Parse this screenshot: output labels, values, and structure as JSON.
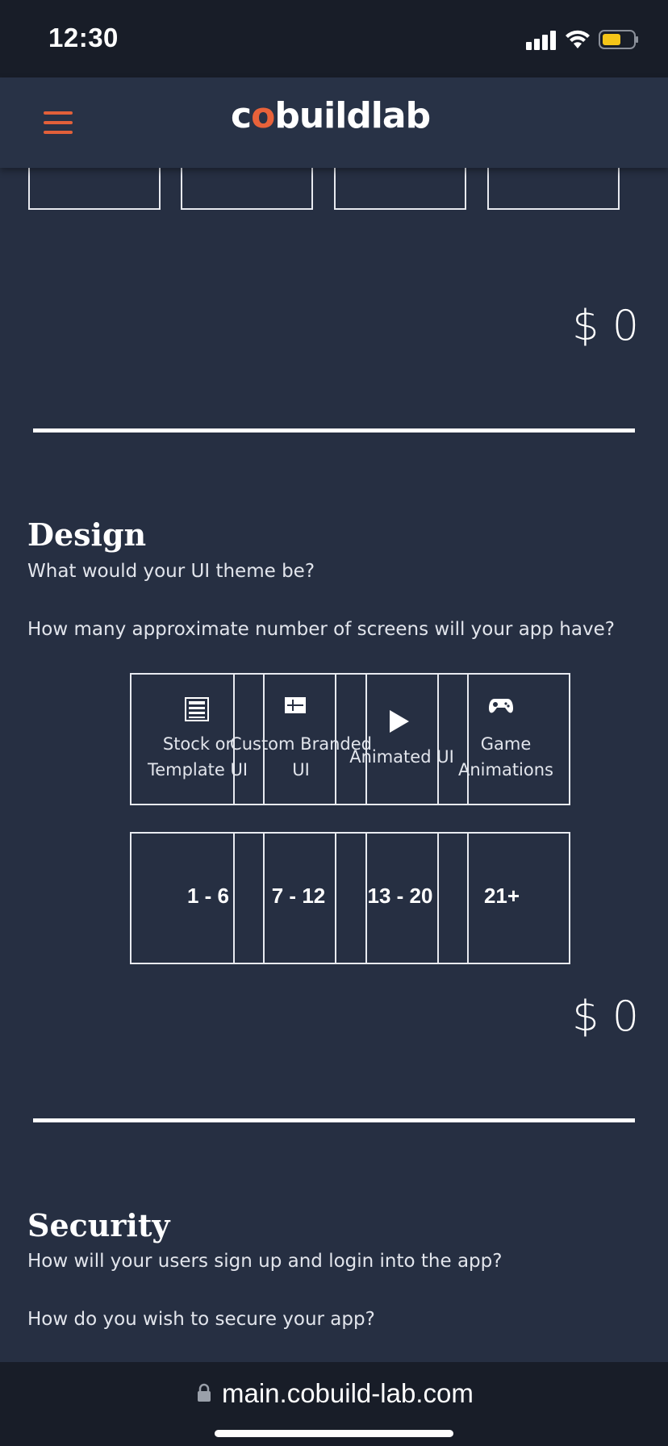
{
  "status_bar": {
    "time": "12:30"
  },
  "header": {
    "logo_pre": "c",
    "logo_o": "o",
    "logo_post": "buildlab"
  },
  "prev_section": {
    "price": "$ 0"
  },
  "design": {
    "title": "Design",
    "question_theme": "What would your UI theme be?",
    "question_screens": "How many approximate number of screens will your app have?",
    "theme_options": [
      {
        "line1": "Stock or",
        "line2": "Template UI",
        "icon": "template-icon"
      },
      {
        "line1": "Custom Branded",
        "line2": "UI",
        "icon": "layout-icon"
      },
      {
        "line1": "Animated UI",
        "line2": "",
        "icon": "play-icon"
      },
      {
        "line1": "Game",
        "line2": "Animations",
        "icon": "gamepad-icon"
      }
    ],
    "screen_options": [
      "1 - 6",
      "7 - 12",
      "13 - 20",
      "21+"
    ],
    "price": "$ 0"
  },
  "security": {
    "title": "Security",
    "question_signup": "How will your users sign up and login into the app?",
    "question_secure": "How do you wish to secure your app?"
  },
  "url_bar": {
    "url": "main.cobuild-lab.com",
    "lock_icon": "lock-icon"
  }
}
